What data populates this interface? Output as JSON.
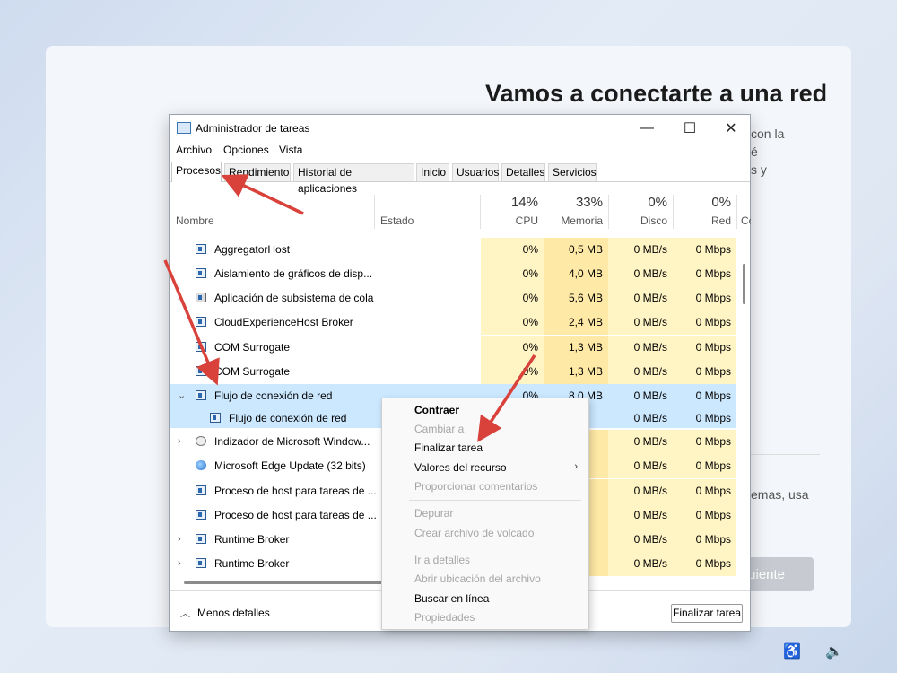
{
  "oobe": {
    "title": "Vamos a conectarte a una red",
    "fragments": [
      "con la",
      "é",
      "s y",
      "emas, usa"
    ],
    "next_label": "uiente"
  },
  "window": {
    "title": "Administrador de tareas",
    "controls": {
      "minimize": "—",
      "maximize": "☐",
      "close": "✕"
    }
  },
  "menubar": [
    "Archivo",
    "Opciones",
    "Vista"
  ],
  "tabs": [
    "Procesos",
    "Rendimiento",
    "Historial de aplicaciones",
    "Inicio",
    "Usuarios",
    "Detalles",
    "Servicios"
  ],
  "header": {
    "name": "Nombre",
    "status": "Estado",
    "cpu": {
      "pct": "14%",
      "label": "CPU"
    },
    "memory": {
      "pct": "33%",
      "label": "Memoria"
    },
    "disk": {
      "pct": "0%",
      "label": "Disco"
    },
    "network": {
      "pct": "0%",
      "label": "Red"
    },
    "extra": "Co"
  },
  "rows": [
    {
      "name": "AggregatorHost",
      "cpu": "0%",
      "mem": "0,5 MB",
      "disk": "0 MB/s",
      "net": "0 Mbps"
    },
    {
      "name": "Aislamiento de gráficos de disp...",
      "cpu": "0%",
      "mem": "4,0 MB",
      "disk": "0 MB/s",
      "net": "0 Mbps"
    },
    {
      "name": "Aplicación de subsistema de cola",
      "cpu": "0%",
      "mem": "5,6 MB",
      "disk": "0 MB/s",
      "net": "0 Mbps"
    },
    {
      "name": "CloudExperienceHost Broker",
      "cpu": "0%",
      "mem": "2,4 MB",
      "disk": "0 MB/s",
      "net": "0 Mbps"
    },
    {
      "name": "COM Surrogate",
      "cpu": "0%",
      "mem": "1,3 MB",
      "disk": "0 MB/s",
      "net": "0 Mbps"
    },
    {
      "name": "COM Surrogate",
      "cpu": "0%",
      "mem": "1,3 MB",
      "disk": "0 MB/s",
      "net": "0 Mbps"
    },
    {
      "name": "Flujo de conexión de red",
      "cpu": "0%",
      "mem": "8,0 MB",
      "disk": "0 MB/s",
      "net": "0 Mbps"
    },
    {
      "name": "Flujo de conexión de red",
      "cpu": "",
      "mem": "",
      "disk": "0 MB/s",
      "net": "0 Mbps"
    },
    {
      "name": "Indizador de Microsoft Window...",
      "cpu": "",
      "mem": "",
      "disk": "0 MB/s",
      "net": "0 Mbps"
    },
    {
      "name": "Microsoft Edge Update (32 bits)",
      "cpu": "",
      "mem": "",
      "disk": "0 MB/s",
      "net": "0 Mbps"
    },
    {
      "name": "Proceso de host para tareas de ...",
      "cpu": "",
      "mem": "",
      "disk": "0 MB/s",
      "net": "0 Mbps"
    },
    {
      "name": "Proceso de host para tareas de ...",
      "cpu": "",
      "mem": "",
      "disk": "0 MB/s",
      "net": "0 Mbps"
    },
    {
      "name": "Runtime Broker",
      "cpu": "",
      "mem": "",
      "disk": "0 MB/s",
      "net": "0 Mbps"
    },
    {
      "name": "Runtime Broker",
      "cpu": "",
      "mem": "",
      "disk": "0 MB/s",
      "net": "0 Mbps"
    }
  ],
  "footer": {
    "less_details": "Menos detalles",
    "end_task": "Finalizar tarea"
  },
  "context_menu": {
    "collapse": "Contraer",
    "switch_to": "Cambiar a",
    "end_task": "Finalizar tarea",
    "resource_values": "Valores del recurso",
    "feedback": "Proporcionar comentarios",
    "debug": "Depurar",
    "create_dump": "Crear archivo de volcado",
    "go_to_details": "Ir a detalles",
    "open_location": "Abrir ubicación del archivo",
    "search_online": "Buscar en línea",
    "properties": "Propiedades"
  },
  "colors": {
    "cpu_heat": "#fff4c4",
    "mem_heat": "#ffe9a6",
    "selection": "#cce8ff",
    "arrow": "#d9423b"
  }
}
